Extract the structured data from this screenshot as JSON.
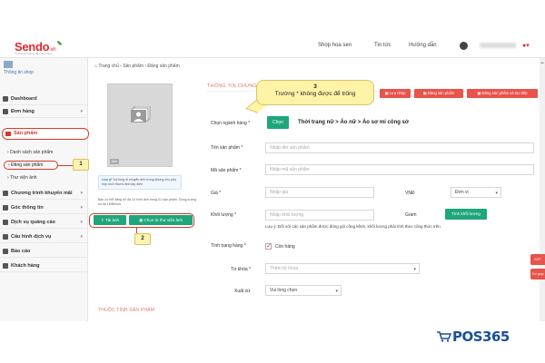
{
  "header": {
    "logo": "Sendo",
    "logo_suffix": ".vn",
    "logo_tagline": "Trực tuyến hàng đầu Việt Nam",
    "nav": [
      "Shop hoa sen",
      "Tin tức",
      "Hướng dẫn"
    ],
    "user_name": "••••••••"
  },
  "sidebar": {
    "shop_link": "Thông tin shop",
    "items": [
      {
        "label": "Dashboard"
      },
      {
        "label": "Đơn hàng"
      },
      {
        "label": "Sản phẩm"
      },
      {
        "label": "Chương trình khuyến mãi"
      },
      {
        "label": "Góc thông tin"
      },
      {
        "label": "Dịch vụ quảng cáo"
      },
      {
        "label": "Cấu hình dịch vụ"
      },
      {
        "label": "Báo cáo"
      },
      {
        "label": "Khách hàng"
      }
    ],
    "sub_items": [
      "Danh sách sản phẩm",
      "Đăng sản phẩm",
      "Thư viện ảnh"
    ],
    "badge_1": "1"
  },
  "breadcrumb": "Trang chủ  ›  Sản phẩm  ›  Đăng sản phẩm",
  "image_panel": {
    "size_label": "Ảnh",
    "note_title": "Lưu ý!",
    "note_text": "Vui lòng di chuyển ảnh trong khung cho phù hợp kích thước ảnh lấy diện",
    "info_text": "Bạn có thể đăng tối đa 10 hình ảnh trong 01 sản phẩm. Dung lượng tối đa 1MB/hình.",
    "upload_button": "Tải ảnh",
    "library_button": "Chọn từ thư viện ảnh",
    "badge_2": "2",
    "bottom_section": "THUỘC TÍNH SẢN PHẨM"
  },
  "form": {
    "section_title": "THÔNG TIN CHUNG",
    "callout_number": "3",
    "callout_text": "Trường * không được để trống",
    "buttons": [
      "Lưu nháp",
      "Đăng sản phẩm",
      "Đăng sản phẩm và tạo tiếp"
    ],
    "category_label": "Chọn ngành hàng *",
    "category_button": "Chọn",
    "category_value": "Thời trang nữ > Áo nữ > Áo sơ mi công sở",
    "name_label": "Tên sản phẩm *",
    "name_placeholder": "Nhập tên sản phẩm",
    "code_label": "Mã sản phẩm *",
    "code_placeholder": "Nhập mã sản phẩm",
    "price_label": "Giá *",
    "price_placeholder": "Nhập giá",
    "currency": "VNĐ",
    "unit_value": "Đơn vị",
    "weight_label": "Khối lượng *",
    "weight_placeholder": "Nhập khối lượng",
    "weight_unit": "Gram",
    "weight_button": "Tính khối lượng",
    "weight_hint": "Lưu ý: Đối với các sản phẩm được đóng gói cồng kềnh, khối lượng phải tính theo công thức trên",
    "stock_label": "Tình trạng hàng *",
    "stock_value": "Còn hàng",
    "keyword_label": "Từ khóa *",
    "keyword_placeholder": "Thêm từ khóa",
    "origin_label": "Xuất xứ",
    "origin_value": "Vui lòng chọn"
  },
  "side_tabs": [
    "SỐP",
    "Trợ giúp"
  ],
  "watermark": "POS365",
  "colors": {
    "brand_red": "#e2282c",
    "green": "#1fa67a",
    "button_red": "#e8534a",
    "callout_yellow": "#fff3a8"
  }
}
